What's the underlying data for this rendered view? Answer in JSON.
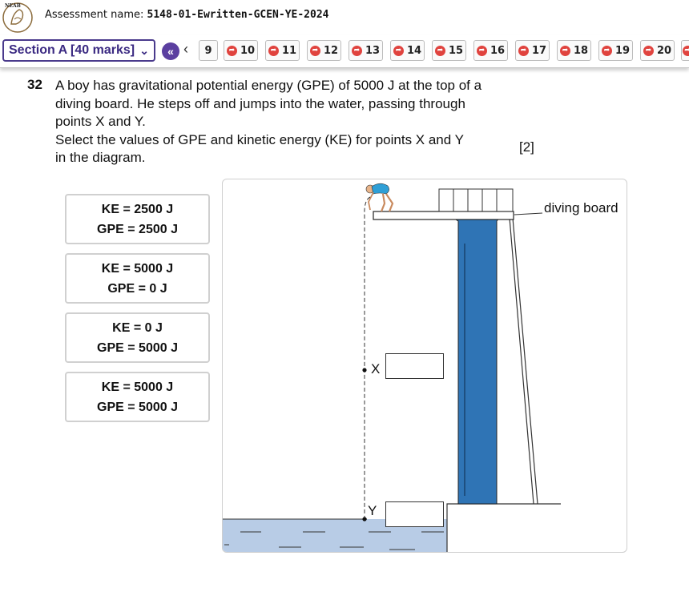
{
  "header": {
    "logo_text": "NEAB",
    "assessment_label": "Assessment name:",
    "assessment_name": "5148-01-Ewritten-GCEN-YE-2024"
  },
  "nav": {
    "section_label": "Section A [40 marks]",
    "questions": [
      "9",
      "10",
      "11",
      "12",
      "13",
      "14",
      "15",
      "16",
      "17",
      "18",
      "19",
      "20"
    ]
  },
  "question": {
    "number": "32",
    "lines": [
      "A boy has gravitational potential energy (GPE) of 5000 J at the top of a",
      "diving board. He steps off and jumps into the water, passing through",
      "points X and Y.",
      "Select the values of GPE and kinetic energy (KE) for points X and Y",
      "in the diagram."
    ],
    "marks": "[2]"
  },
  "answers": [
    {
      "ke": "KE = 2500 J",
      "gpe": "GPE = 2500 J"
    },
    {
      "ke": "KE = 5000 J",
      "gpe": "GPE = 0 J"
    },
    {
      "ke": "KE = 0 J",
      "gpe": "GPE = 5000 J"
    },
    {
      "ke": "KE = 5000 J",
      "gpe": "GPE = 5000 J"
    }
  ],
  "diagram": {
    "board_label": "diving board",
    "point_x": "X",
    "point_y": "Y"
  },
  "colors": {
    "accent": "#3b2a82",
    "flag": "#e0433e",
    "tower": "#2f74b5",
    "water": "#b8cce6"
  }
}
